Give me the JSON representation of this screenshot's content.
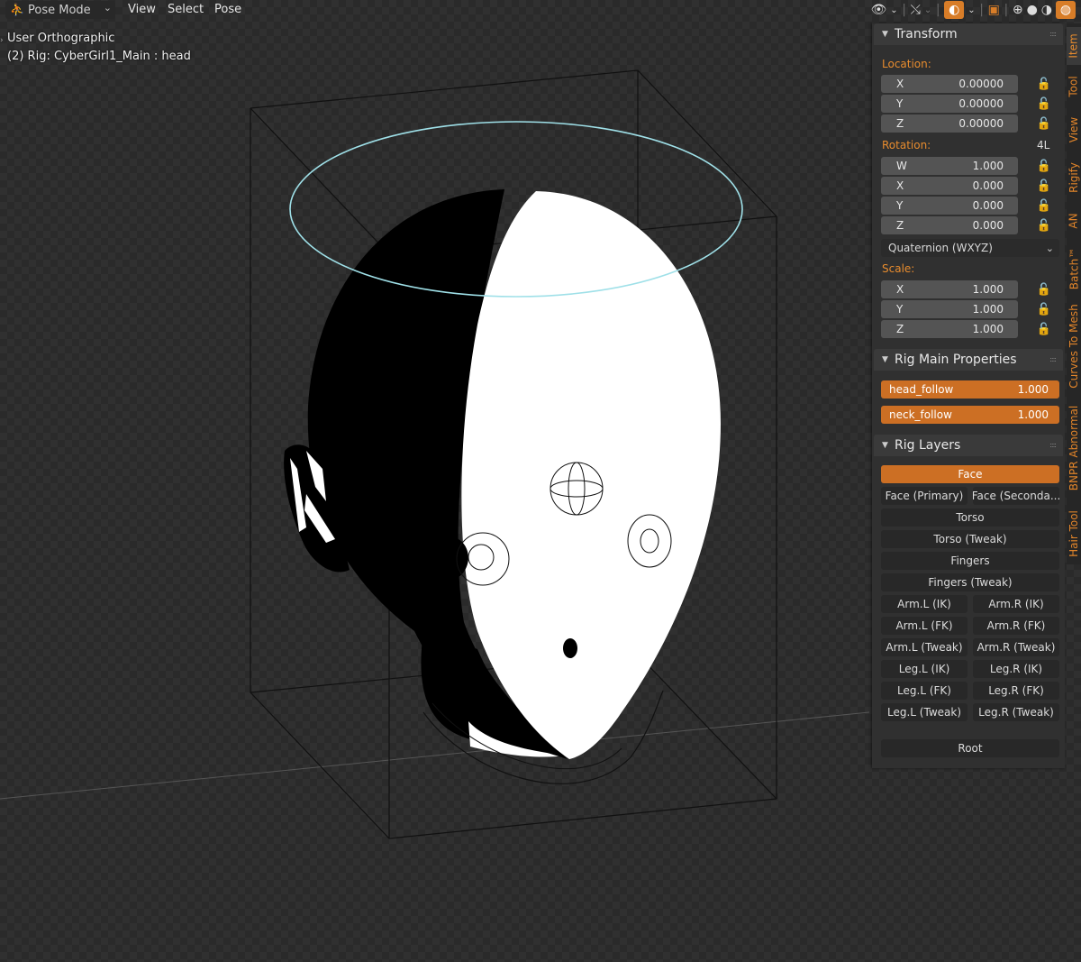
{
  "header": {
    "mode": "Pose Mode",
    "menus": [
      "View",
      "Select",
      "Pose"
    ],
    "icons": [
      "visibility-icon",
      "gizmo-icon",
      "overlay-icon",
      "xray-icon",
      "wireframe-shading-icon",
      "solid-shading-icon",
      "material-shading-icon",
      "rendered-shading-icon"
    ]
  },
  "viewport": {
    "view_name": "User Orthographic",
    "object_info": "(2) Rig: CyberGirl1_Main : head"
  },
  "transform": {
    "title": "Transform",
    "location_label": "Location:",
    "location": [
      {
        "axis": "X",
        "value": "0.00000"
      },
      {
        "axis": "Y",
        "value": "0.00000"
      },
      {
        "axis": "Z",
        "value": "0.00000"
      }
    ],
    "rotation_label": "Rotation:",
    "rotation_lock_label": "4L",
    "rotation": [
      {
        "axis": "W",
        "value": "1.000"
      },
      {
        "axis": "X",
        "value": "0.000"
      },
      {
        "axis": "Y",
        "value": "0.000"
      },
      {
        "axis": "Z",
        "value": "0.000"
      }
    ],
    "rotation_mode": "Quaternion (WXYZ)",
    "scale_label": "Scale:",
    "scale": [
      {
        "axis": "X",
        "value": "1.000"
      },
      {
        "axis": "Y",
        "value": "1.000"
      },
      {
        "axis": "Z",
        "value": "1.000"
      }
    ]
  },
  "rig_main": {
    "title": "Rig Main Properties",
    "props": [
      {
        "name": "head_follow",
        "value": "1.000"
      },
      {
        "name": "neck_follow",
        "value": "1.000"
      }
    ]
  },
  "rig_layers": {
    "title": "Rig Layers",
    "face": "Face",
    "face_primary": "Face (Primary)",
    "face_secondary": "Face (Seconda...",
    "torso": "Torso",
    "torso_tweak": "Torso (Tweak)",
    "fingers": "Fingers",
    "fingers_tweak": "Fingers (Tweak)",
    "pairs": [
      [
        "Arm.L (IK)",
        "Arm.R (IK)"
      ],
      [
        "Arm.L (FK)",
        "Arm.R (FK)"
      ],
      [
        "Arm.L (Tweak)",
        "Arm.R (Tweak)"
      ],
      [
        "Leg.L (IK)",
        "Leg.R (IK)"
      ],
      [
        "Leg.L (FK)",
        "Leg.R (FK)"
      ],
      [
        "Leg.L (Tweak)",
        "Leg.R (Tweak)"
      ]
    ],
    "root": "Root"
  },
  "tabs": {
    "item": "Item",
    "tool": "Tool",
    "view": "View",
    "rigify": "Rigify",
    "an": "AN",
    "batch": "Batch™",
    "curves_to_mesh": "Curves To Mesh",
    "bnpr": "BNPR Abnormal",
    "hair_tool": "Hair Tool"
  },
  "colors": {
    "accent": "#cc6f24",
    "label_orange": "#e88c2e",
    "bone_selected": "#9fe0e8"
  }
}
